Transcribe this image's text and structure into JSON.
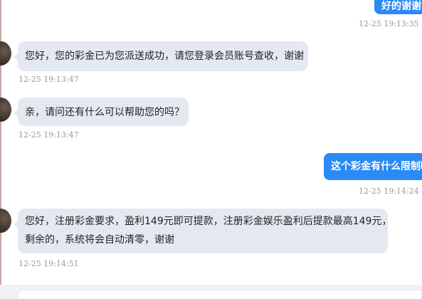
{
  "messages": [
    {
      "type": "out",
      "text": "好的谢谢",
      "time": "12-25 19:13:35"
    },
    {
      "type": "in",
      "text": "您好，您的彩金已为您派送成功，请您登录会员账号查收，谢谢",
      "time": "12-25 19:13:47"
    },
    {
      "type": "in",
      "text": "亲，请问还有什么可以帮助您的吗？",
      "time": "12-25 19:13:47"
    },
    {
      "type": "out",
      "text": "这个彩金有什么限制吗",
      "time": "12-25 19:14:24"
    },
    {
      "type": "in",
      "line1": "您好，注册彩金要求，盈利149元即可提款，注册彩金娱乐盈利后提款最高149元，",
      "line2": "剩余的，系统将会自动清零，谢谢",
      "time": "12-25 19:14:51"
    }
  ],
  "colors": {
    "incoming_bubble": "#e4e9f1",
    "outgoing_bubble": "#2a8af6",
    "timestamp": "#999999"
  }
}
